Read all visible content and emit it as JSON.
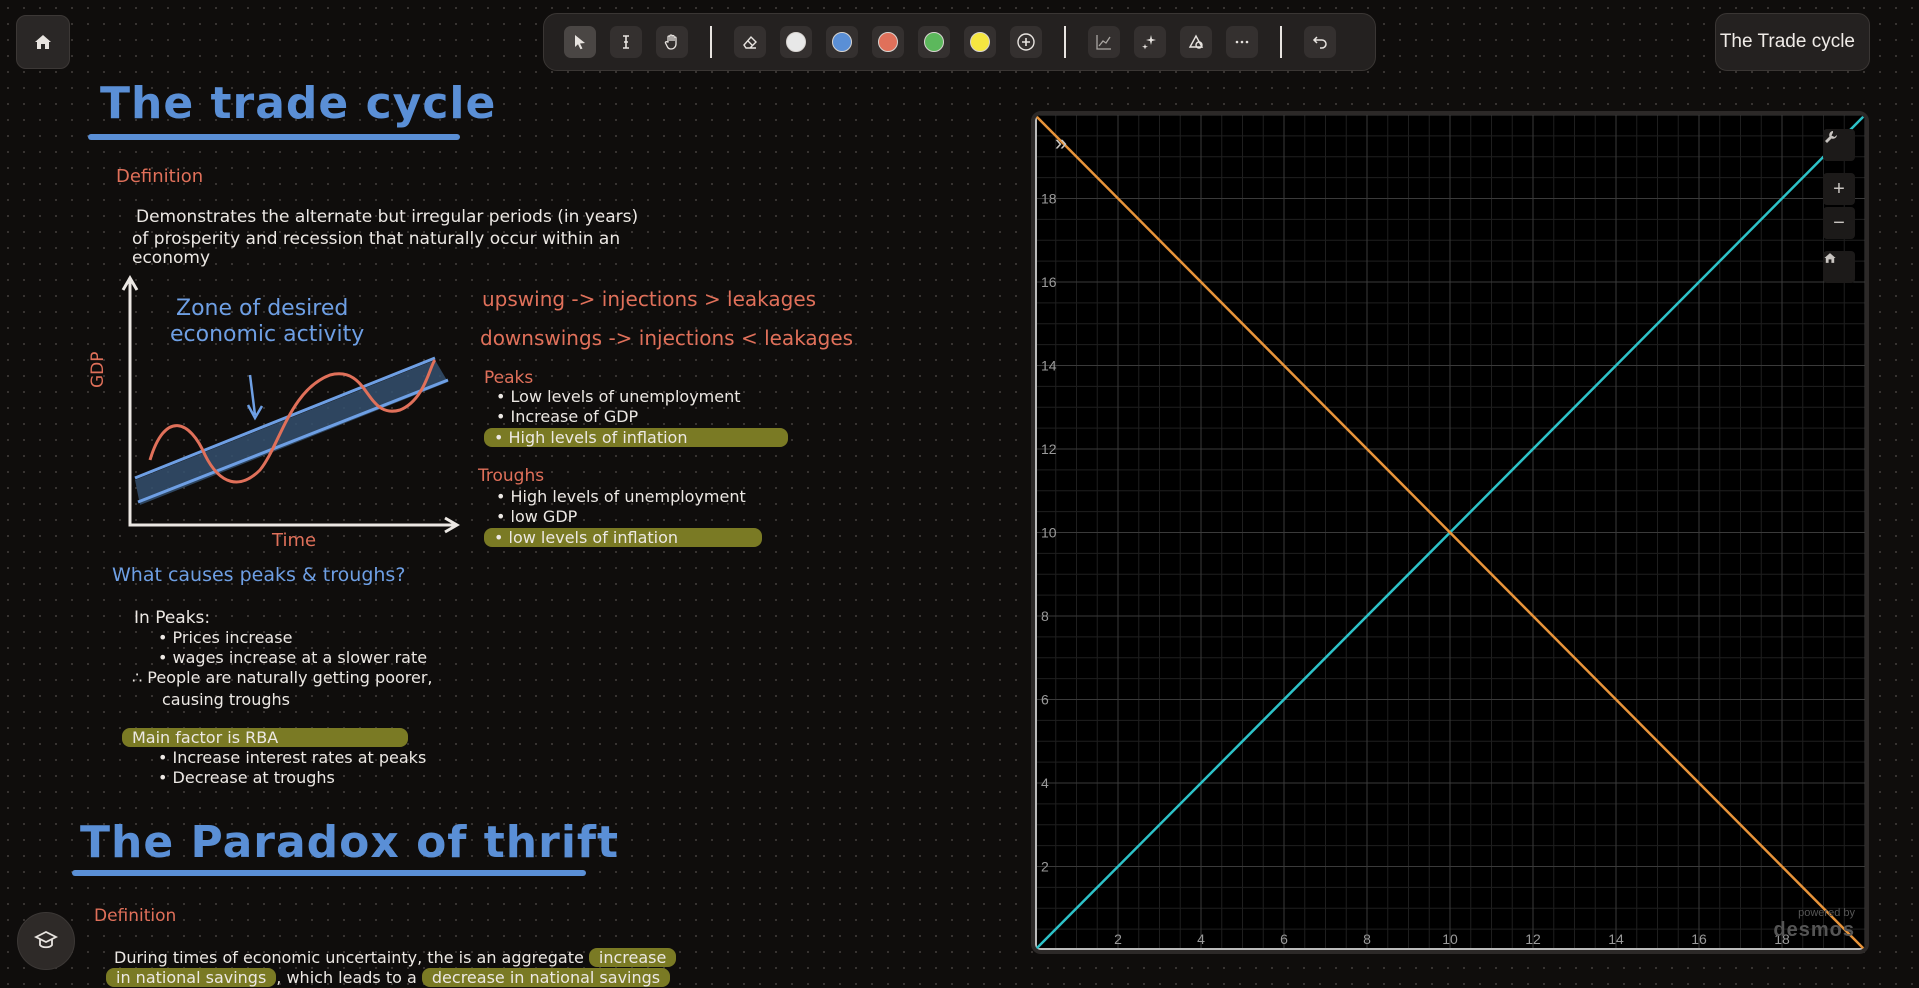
{
  "window": {
    "title": "The Trade cycle"
  },
  "toolbar": {
    "tools": [
      {
        "name": "select-tool",
        "icon": "cursor-icon"
      },
      {
        "name": "text-tool",
        "icon": "text-cursor-icon"
      },
      {
        "name": "pan-tool",
        "icon": "hand-icon"
      }
    ],
    "colors": [
      "#e8e8e8",
      "#5a8fd6",
      "#e0705a",
      "#5cb85c",
      "#f5e640"
    ]
  },
  "notes": {
    "title1": "The trade cycle",
    "definition_label": "Definition",
    "definition_text1": "Demonstrates the alternate but irregular periods (in years)",
    "definition_text2": "of prosperity and recession that naturally occur within an",
    "definition_text3": "economy",
    "sketch_zone_label1": "Zone of desired",
    "sketch_zone_label2": "economic activity",
    "sketch_ylabel": "GDP",
    "sketch_xlabel": "Time",
    "upswing": "upswing -> injections > leakages",
    "downswing": "downswings -> injections < leakages",
    "peaks_label": "Peaks",
    "peaks_items": [
      "• Low levels of unemployment",
      "• Increase of GDP",
      "• High levels of inflation"
    ],
    "troughs_label": "Troughs",
    "troughs_items": [
      "• High levels of unemployment",
      "• low GDP",
      "• low levels of inflation"
    ],
    "causes_q": "What causes peaks & troughs?",
    "in_peaks": "In Peaks:",
    "peaks_causes": [
      "• Prices increase",
      "• wages increase at a slower rate"
    ],
    "therefore1": "∴ People are naturally getting poorer,",
    "therefore2": "causing troughs",
    "main_factor": "Main factor is RBA",
    "rba_items": [
      "• Increase interest rates at peaks",
      "• Decrease at troughs"
    ],
    "title2": "The Paradox of thrift",
    "definition2_label": "Definition",
    "definition2_text1a": "During times of economic uncertainty, the is an aggregate",
    "definition2_text1b": "increase",
    "definition2_text2a": "in national savings",
    "definition2_text2b": ", which leads to a",
    "definition2_text2c": "decrease in national savings"
  },
  "chart_data": {
    "type": "line",
    "xlim": [
      0,
      20
    ],
    "ylim": [
      0,
      20
    ],
    "grid": true,
    "x_ticks": [
      2,
      4,
      6,
      8,
      10,
      12,
      14,
      16,
      18
    ],
    "y_ticks": [
      2,
      4,
      6,
      8,
      10,
      12,
      14,
      16,
      18
    ],
    "series": [
      {
        "color": "#2dc2c8",
        "x": [
          0,
          20
        ],
        "y": [
          0,
          20
        ]
      },
      {
        "color": "#e8943a",
        "x": [
          0,
          20
        ],
        "y": [
          20,
          0
        ]
      }
    ]
  },
  "graph_watermark": {
    "line1": "powered by",
    "line2": "desmos"
  }
}
